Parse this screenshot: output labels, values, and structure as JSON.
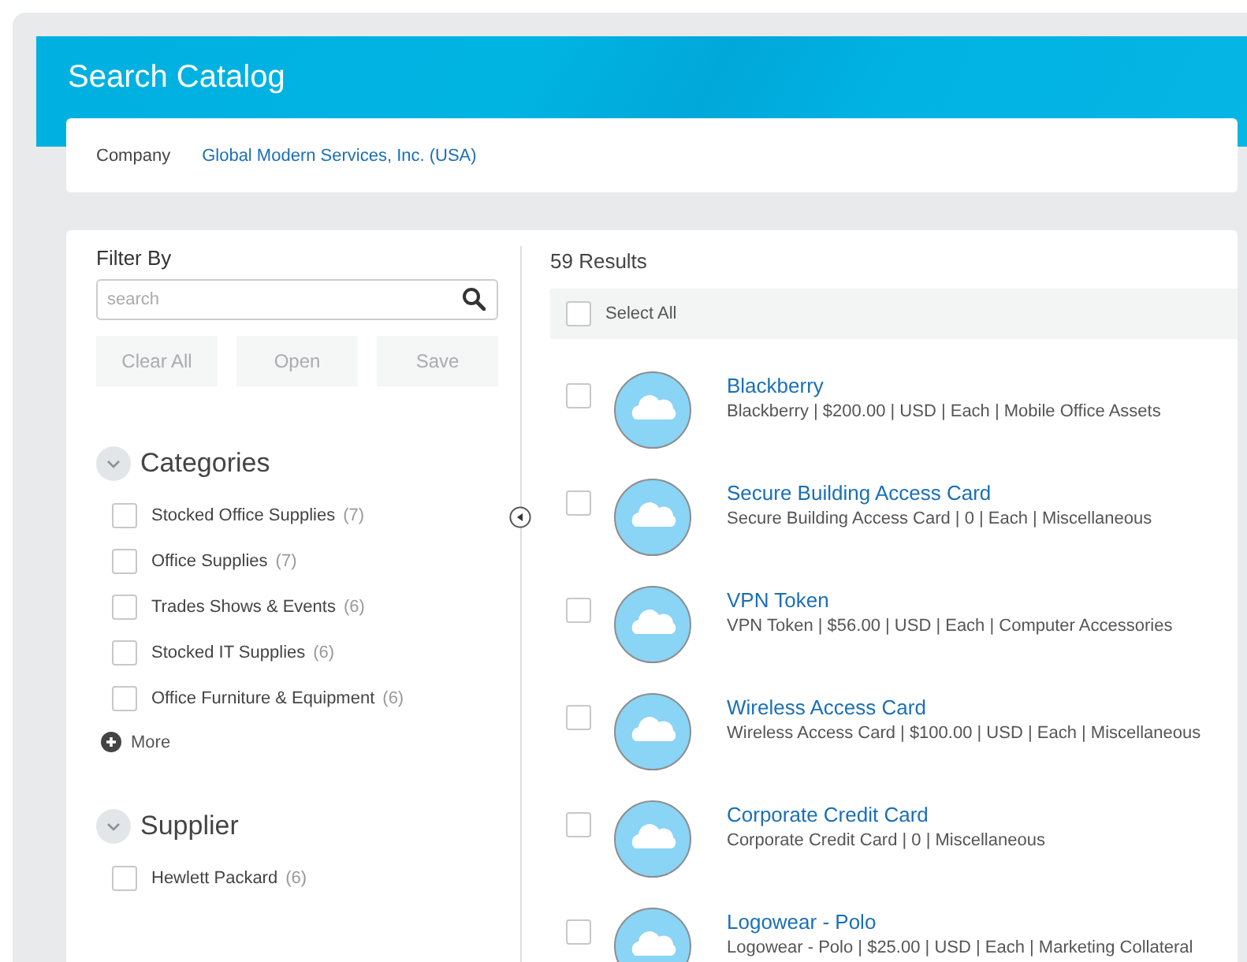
{
  "header": {
    "title": "Search Catalog"
  },
  "company": {
    "label": "Company",
    "value": "Global Modern Services, Inc. (USA)"
  },
  "filter": {
    "title": "Filter By",
    "search": {
      "placeholder": "search"
    },
    "buttons": [
      {
        "label": "Clear All",
        "disabled": true
      },
      {
        "label": "Open",
        "disabled": true
      },
      {
        "label": "Save",
        "disabled": true
      }
    ],
    "sections": [
      {
        "title": "Categories",
        "expanded": true,
        "items": [
          {
            "label": "Stocked Office Supplies",
            "count": "(7)",
            "checked": false
          },
          {
            "label": "Office Supplies",
            "count": "(7)",
            "checked": false
          },
          {
            "label": "Trades Shows & Events",
            "count": "(6)",
            "checked": false
          },
          {
            "label": "Stocked IT Supplies",
            "count": "(6)",
            "checked": false
          },
          {
            "label": "Office Furniture & Equipment",
            "count": "(6)",
            "checked": false
          }
        ],
        "more": "More"
      },
      {
        "title": "Supplier",
        "expanded": true,
        "items": [
          {
            "label": "Hewlett Packard",
            "count": "(6)",
            "checked": false
          }
        ]
      }
    ]
  },
  "results": {
    "count": "59 Results",
    "select_all": {
      "label": "Select All",
      "checked": false
    },
    "items": [
      {
        "name": "Blackberry",
        "details": "Blackberry | $200.00 | USD | Each | Mobile Office Assets",
        "checked": false
      },
      {
        "name": "Secure Building Access Card",
        "details": "Secure Building Access Card | 0 | Each | Miscellaneous",
        "checked": false
      },
      {
        "name": "VPN Token",
        "details": "VPN Token | $56.00 | USD | Each | Computer Accessories",
        "checked": false
      },
      {
        "name": "Wireless Access Card",
        "details": "Wireless Access Card | $100.00 | USD | Each | Miscellaneous",
        "checked": false
      },
      {
        "name": "Corporate Credit Card",
        "details": "Corporate Credit Card | 0 | Miscellaneous",
        "checked": false
      },
      {
        "name": "Logowear - Polo",
        "details": "Logowear - Polo | $25.00 | USD | Each | Marketing Collateral",
        "checked": false
      }
    ]
  }
}
